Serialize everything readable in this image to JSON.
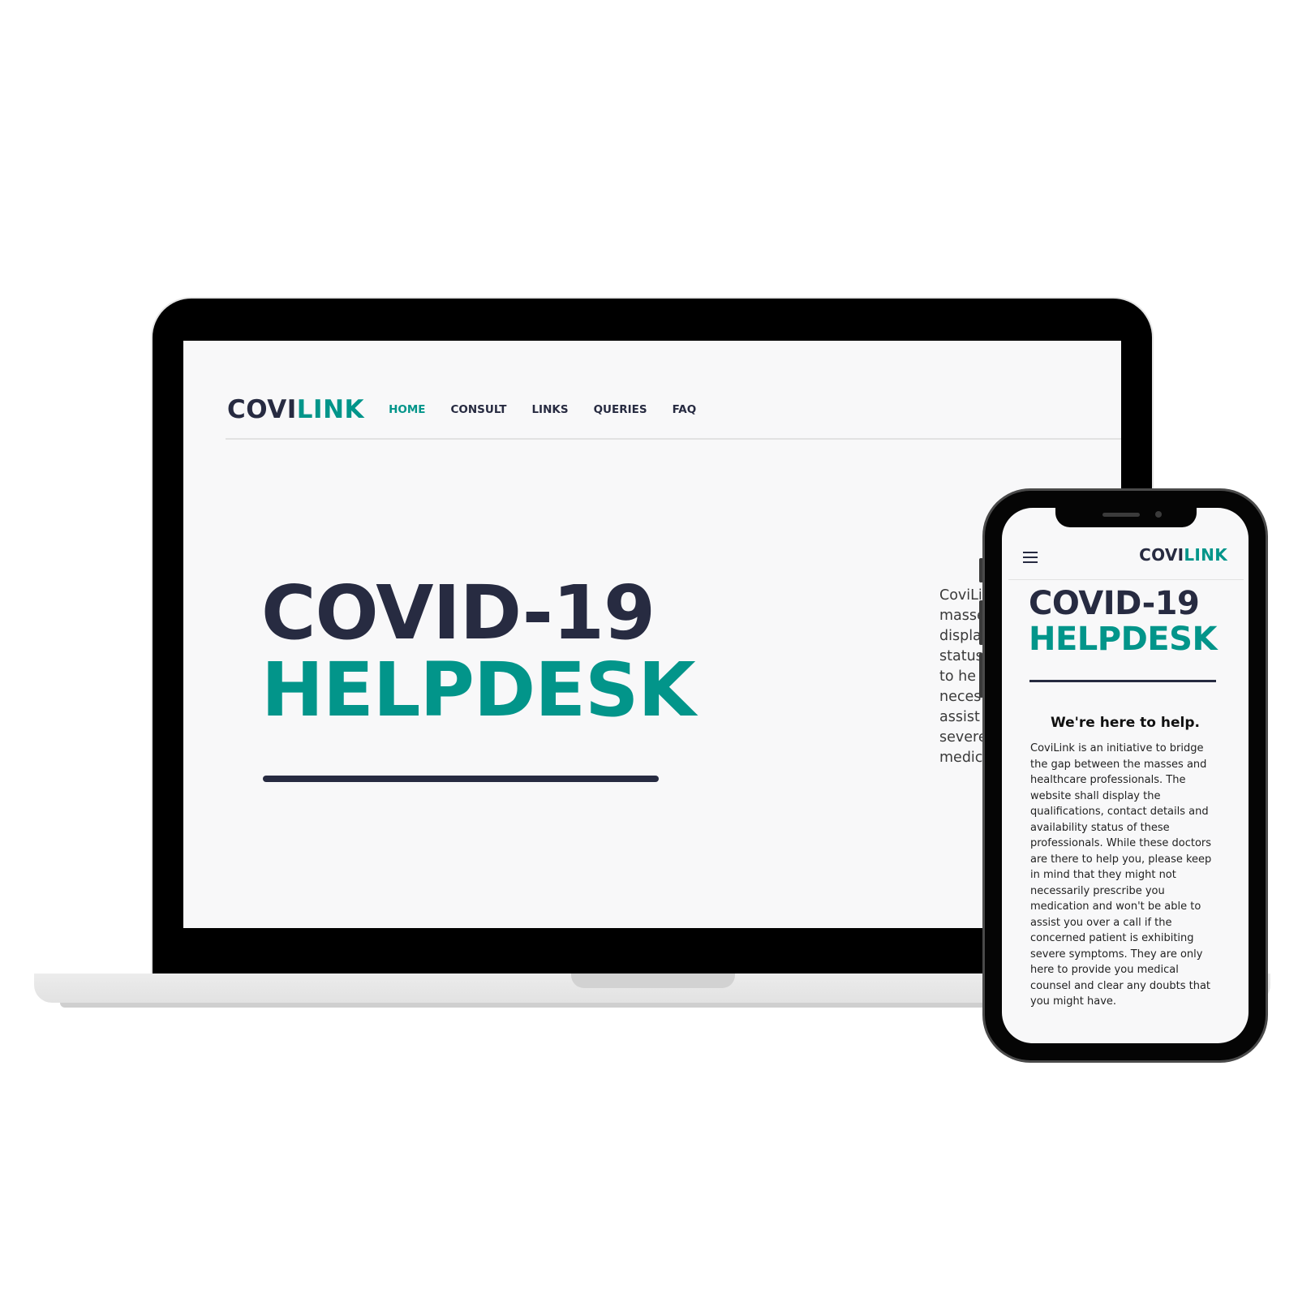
{
  "brand": {
    "part1": "COVI",
    "part2": "LINK"
  },
  "nav": {
    "items": [
      {
        "label": "HOME"
      },
      {
        "label": "CONSULT"
      },
      {
        "label": "LINKS"
      },
      {
        "label": "QUERIES"
      },
      {
        "label": "FAQ"
      }
    ],
    "active": "HOME"
  },
  "hero": {
    "line1": "COVID-19",
    "line2": "HELPDESK"
  },
  "laptop_desc_visible": "CoviLi\nmasse\ndispla\nstatus\nto he\nneces\nassist\nsevere\nmedic",
  "about": {
    "heading": "We're here to help.",
    "body": "CoviLink is an initiative to bridge the gap between the masses and healthcare professionals. The website shall display the qualifications, contact details and availability status of these professionals. While these doctors are there to help you, please keep in mind that they might not necessarily prescribe you medication and won't be able to assist you over a call if the concerned patient is exhibiting severe symptoms. They are only here to provide you medical counsel and clear any doubts that you might have."
  },
  "icons": {
    "menu": "hamburger-menu-icon"
  },
  "colors": {
    "brand_dark": "#272b41",
    "brand_teal": "#02958a",
    "screen_bg": "#f8f8f9",
    "device_frame": "#050505"
  }
}
